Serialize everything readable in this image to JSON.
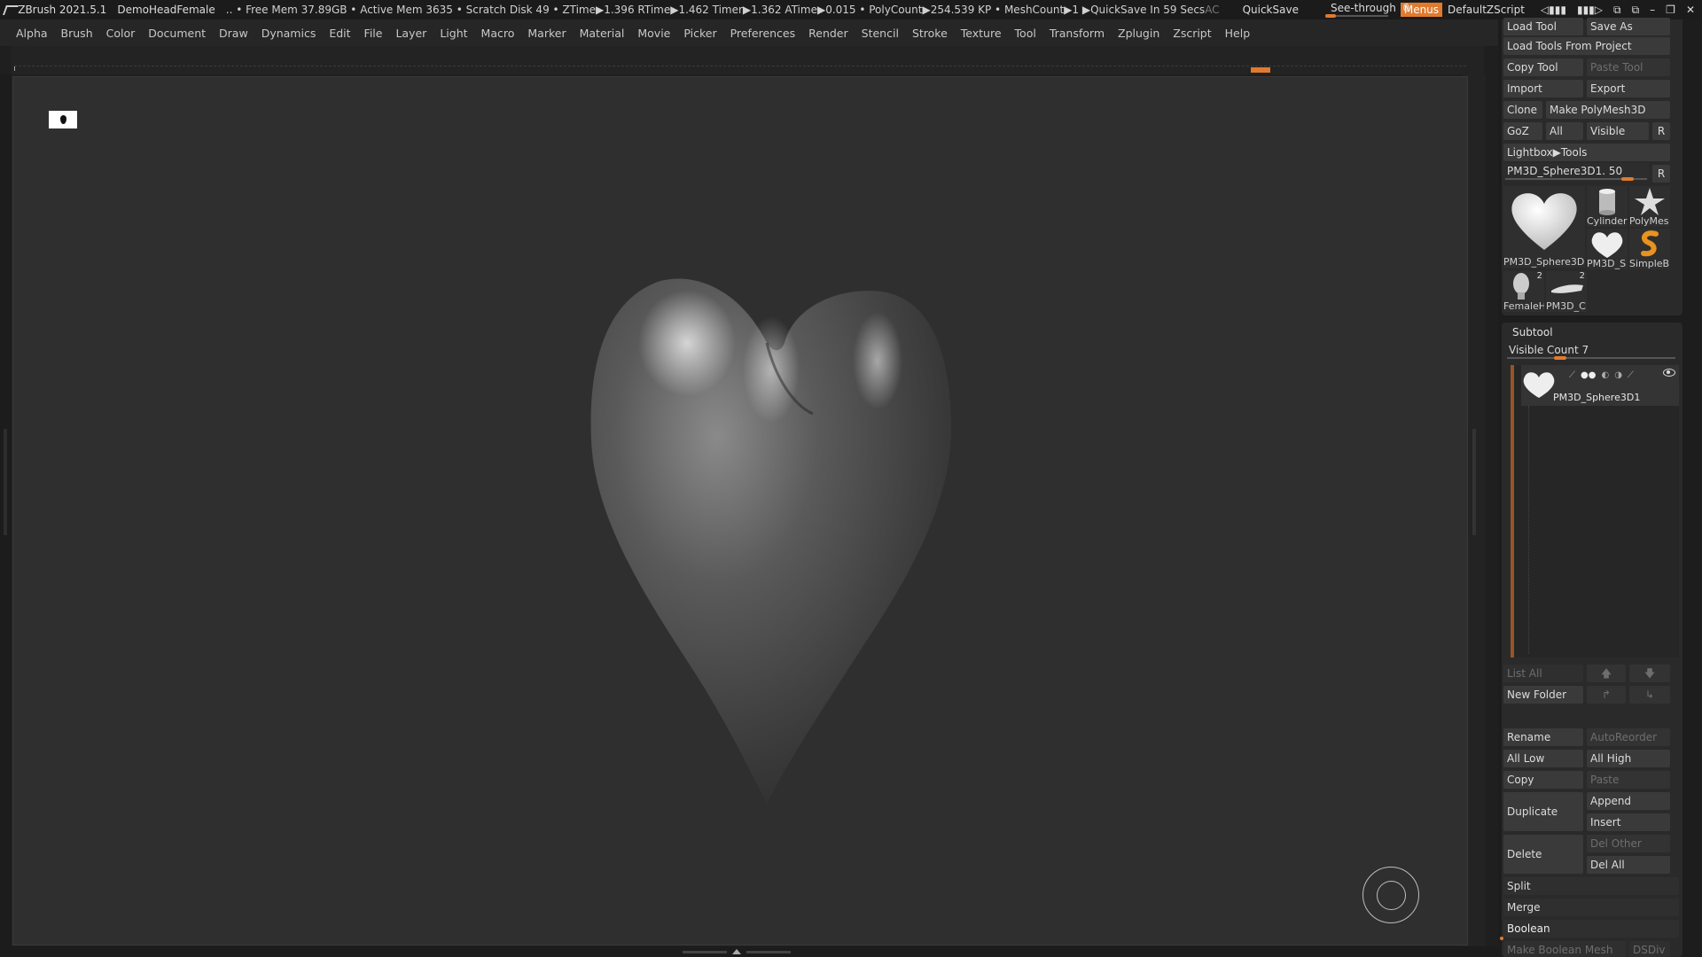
{
  "titlebar": {
    "app": "ZBrush 2021.5.1",
    "document": "DemoHeadFemale",
    "stats": ".. • Free Mem 37.89GB • Active Mem 3635 • Scratch Disk 49 • ZTime▶1.396 RTime▶1.462 Timer▶1.362 ATime▶0.015 • PolyCount▶254.539 KP • MeshCount▶1 ▶QuickSave In 59 Secs",
    "ac": "AC",
    "quicksave": "QuickSave",
    "seethrough_label": "See-through",
    "seethrough_value": "0",
    "menus": "Menus",
    "script": "DefaultZScript",
    "controls": [
      "◁▮▮▮",
      "▮▮▮▷",
      "⧉",
      "⧉",
      "–",
      "❐",
      "✕"
    ]
  },
  "menubar": [
    "Alpha",
    "Brush",
    "Color",
    "Document",
    "Draw",
    "Dynamics",
    "Edit",
    "File",
    "Layer",
    "Light",
    "Macro",
    "Marker",
    "Material",
    "Movie",
    "Picker",
    "Preferences",
    "Render",
    "Stencil",
    "Stroke",
    "Texture",
    "Tool",
    "Transform",
    "Zplugin",
    "Zscript",
    "Help"
  ],
  "tool": {
    "load_tool": "Load Tool",
    "save_as": "Save As",
    "load_from_project": "Load Tools From Project",
    "copy_tool": "Copy Tool",
    "paste_tool": "Paste Tool",
    "import": "Import",
    "export": "Export",
    "clone": "Clone",
    "make_polymesh": "Make PolyMesh3D",
    "goz": "GoZ",
    "all": "All",
    "visible": "Visible",
    "r": "R",
    "lightbox": "Lightbox▶Tools",
    "current_tool_slider": "PM3D_Sphere3D1. 50",
    "current_tool_value": 0.9,
    "thumbs": [
      {
        "label": "PM3D_Sphere3D",
        "icon": "heart-icon"
      },
      {
        "label": "Cylinder",
        "icon": "cylinder-icon"
      },
      {
        "label": "PolyMes",
        "icon": "star-icon"
      },
      {
        "label": "PM3D_S",
        "icon": "heart-icon"
      },
      {
        "label": "SimpleB",
        "icon": "snake-icon"
      },
      {
        "label": "FemaleH",
        "icon": "head-icon",
        "count": "2"
      },
      {
        "label": "PM3D_C",
        "icon": "shape-icon",
        "count": "2"
      }
    ]
  },
  "subtool": {
    "header": "Subtool",
    "visible_count": "Visible Count 7",
    "visible_count_value": 0.3,
    "item_name": "PM3D_Sphere3D1",
    "list_all": "List All",
    "new_folder": "New Folder",
    "rename": "Rename",
    "autoreorder": "AutoReorder",
    "all_low": "All Low",
    "all_high": "All High",
    "copy": "Copy",
    "paste": "Paste",
    "duplicate": "Duplicate",
    "append": "Append",
    "insert": "Insert",
    "delete": "Delete",
    "del_other": "Del Other",
    "del_all": "Del All",
    "split": "Split",
    "merge": "Merge",
    "boolean": "Boolean",
    "make_boolean_mesh": "Make Boolean Mesh",
    "dsdiv": "DSDiv"
  },
  "colors": {
    "accent": "#e07a2e",
    "canvas": "#2f2f2f",
    "panel": "#2a2a2a"
  }
}
